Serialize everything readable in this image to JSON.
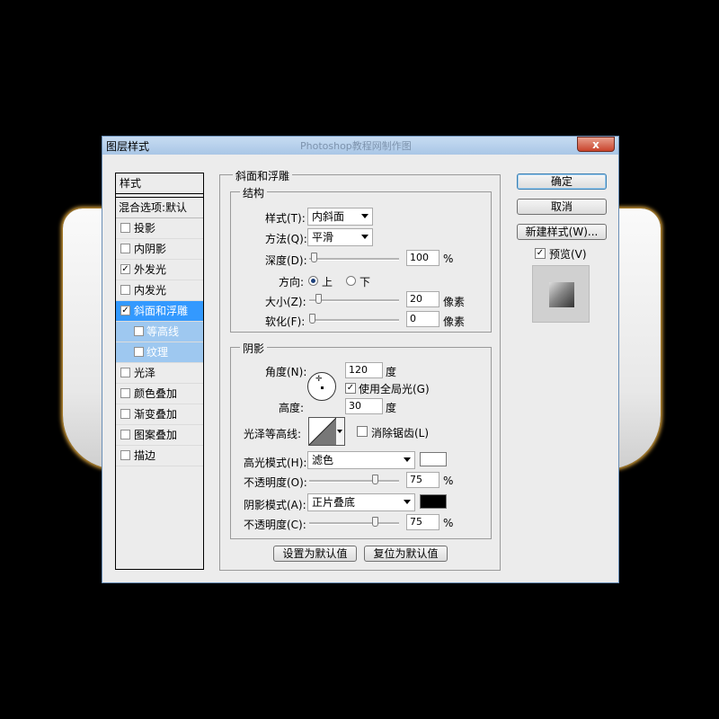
{
  "dialog": {
    "title": "图层样式",
    "ghost_title": "Photoshop教程网制作图",
    "close_label": "x"
  },
  "style_list": {
    "header": "样式",
    "mix_label": "混合选项:默认",
    "items": [
      {
        "label": "投影",
        "checked": false
      },
      {
        "label": "内阴影",
        "checked": false
      },
      {
        "label": "外发光",
        "checked": true
      },
      {
        "label": "内发光",
        "checked": false
      },
      {
        "label": "斜面和浮雕",
        "checked": true,
        "active": true
      },
      {
        "label": "等高线",
        "checked": false,
        "sub": true
      },
      {
        "label": "纹理",
        "checked": false,
        "sub": true
      },
      {
        "label": "光泽",
        "checked": false
      },
      {
        "label": "颜色叠加",
        "checked": false
      },
      {
        "label": "渐变叠加",
        "checked": false
      },
      {
        "label": "图案叠加",
        "checked": false
      },
      {
        "label": "描边",
        "checked": false
      }
    ]
  },
  "buttons": {
    "ok": "确定",
    "cancel": "取消",
    "new_style": "新建样式(W)...",
    "preview": "预览(V)",
    "preview_checked": true
  },
  "bevel": {
    "title": "斜面和浮雕",
    "structure": {
      "title": "结构",
      "style_label": "样式(T):",
      "style_value": "内斜面",
      "method_label": "方法(Q):",
      "method_value": "平滑",
      "depth_label": "深度(D):",
      "depth_value": "100",
      "depth_unit": "%",
      "depth_level": 0.02,
      "direction_label": "方向:",
      "direction_up": "上",
      "direction_down": "下",
      "direction_selected": "up",
      "size_label": "大小(Z):",
      "size_value": "20",
      "size_unit": "像素",
      "size_level": 0.08,
      "soften_label": "软化(F):",
      "soften_value": "0",
      "soften_unit": "像素",
      "soften_level": 0
    },
    "shading": {
      "title": "阴影",
      "angle_label": "角度(N):",
      "angle_value": "120",
      "angle_unit": "度",
      "global_light_label": "使用全局光(G)",
      "global_light_checked": true,
      "altitude_label": "高度:",
      "altitude_value": "30",
      "altitude_unit": "度",
      "gloss_label": "光泽等高线:",
      "antialias_label": "消除锯齿(L)",
      "antialias_checked": false,
      "highlight_mode_label": "高光模式(H):",
      "highlight_mode_value": "滤色",
      "highlight_color": "#ffffff",
      "highlight_opacity_label": "不透明度(O):",
      "highlight_opacity_value": "75",
      "highlight_opacity_unit": "%",
      "highlight_opacity_level": 0.75,
      "shadow_mode_label": "阴影模式(A):",
      "shadow_mode_value": "正片叠底",
      "shadow_color": "#000000",
      "shadow_opacity_label": "不透明度(C):",
      "shadow_opacity_value": "75",
      "shadow_opacity_unit": "%",
      "shadow_opacity_level": 0.75
    },
    "make_default": "设置为默认值",
    "reset_default": "复位为默认值"
  }
}
